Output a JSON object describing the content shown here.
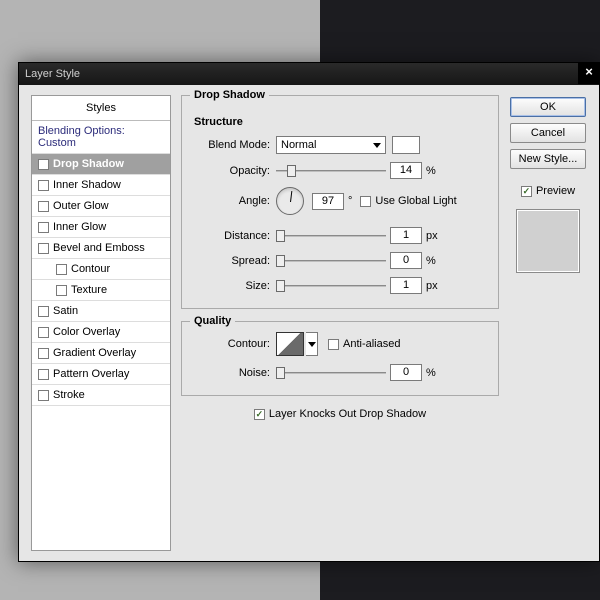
{
  "dialog": {
    "title": "Layer Style"
  },
  "styles": {
    "header": "Styles",
    "items": [
      {
        "label": "Blending Options: Custom",
        "checkbox": false
      },
      {
        "label": "Drop Shadow",
        "checkbox": true,
        "checked": true,
        "selected": true
      },
      {
        "label": "Inner Shadow",
        "checkbox": true
      },
      {
        "label": "Outer Glow",
        "checkbox": true
      },
      {
        "label": "Inner Glow",
        "checkbox": true
      },
      {
        "label": "Bevel and Emboss",
        "checkbox": true
      },
      {
        "label": "Contour",
        "checkbox": true,
        "indent": true
      },
      {
        "label": "Texture",
        "checkbox": true,
        "indent": true
      },
      {
        "label": "Satin",
        "checkbox": true
      },
      {
        "label": "Color Overlay",
        "checkbox": true
      },
      {
        "label": "Gradient Overlay",
        "checkbox": true
      },
      {
        "label": "Pattern Overlay",
        "checkbox": true
      },
      {
        "label": "Stroke",
        "checkbox": true
      }
    ]
  },
  "panel": {
    "title": "Drop Shadow",
    "structure": {
      "heading": "Structure",
      "blend_mode": {
        "label": "Blend Mode:",
        "value": "Normal",
        "swatch": "#ffffff"
      },
      "opacity": {
        "label": "Opacity:",
        "value": "14",
        "unit": "%"
      },
      "angle": {
        "label": "Angle:",
        "value": "97",
        "unit": "°",
        "global_label": "Use Global Light",
        "global": false
      },
      "distance": {
        "label": "Distance:",
        "value": "1",
        "unit": "px"
      },
      "spread": {
        "label": "Spread:",
        "value": "0",
        "unit": "%"
      },
      "size": {
        "label": "Size:",
        "value": "1",
        "unit": "px"
      }
    },
    "quality": {
      "heading": "Quality",
      "contour": {
        "label": "Contour:",
        "aa_label": "Anti-aliased",
        "aa": false
      },
      "noise": {
        "label": "Noise:",
        "value": "0",
        "unit": "%"
      }
    },
    "knockout": {
      "label": "Layer Knocks Out Drop Shadow",
      "checked": true
    }
  },
  "buttons": {
    "ok": "OK",
    "cancel": "Cancel",
    "new_style": "New Style..."
  },
  "preview": {
    "label": "Preview",
    "checked": true
  }
}
